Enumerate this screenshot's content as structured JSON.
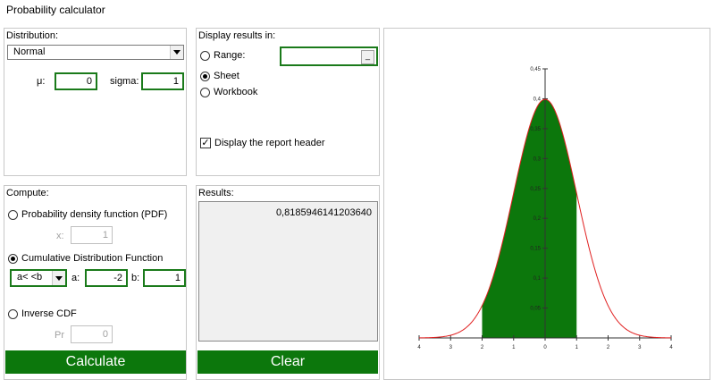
{
  "window": {
    "title": "Probability calculator"
  },
  "distribution": {
    "label": "Distribution:",
    "selected": "Normal",
    "mu_label": "μ:",
    "mu_value": "0",
    "sigma_label": "sigma:",
    "sigma_value": "1"
  },
  "display": {
    "label": "Display results in:",
    "range_label": "Range:",
    "range_value": "",
    "range_button": "_",
    "sheet_label": "Sheet",
    "workbook_label": "Workbook",
    "selected": "sheet",
    "header_label": "Display the report header",
    "header_checked": true
  },
  "compute": {
    "label": "Compute:",
    "pdf_label": "Probability density function (PDF)",
    "x_label": "x:",
    "x_value": "1",
    "cdf_label": "Cumulative Distribution Function",
    "cdf_selected": true,
    "cdf_mode": "a< <b",
    "a_label": "a:",
    "a_value": "-2",
    "b_label": "b:",
    "b_value": "1",
    "inv_label": "Inverse CDF",
    "pr_label": "Pr",
    "pr_value": "0"
  },
  "results": {
    "label": "Results:",
    "value": "0,8185946141203640"
  },
  "buttons": {
    "calculate": "Calculate",
    "clear": "Clear"
  },
  "colors": {
    "accent": "#0c770c",
    "input_border": "#1a7a1a",
    "curve": "#e02020",
    "fill": "#0c770c"
  },
  "chart_data": {
    "type": "area",
    "curve": "normal-pdf",
    "mu": 0,
    "sigma": 1,
    "shaded_from": -2,
    "shaded_to": 1,
    "xlim": [
      -4,
      4
    ],
    "ylim": [
      0,
      0.45
    ],
    "x_ticks": [
      "4",
      "3",
      "2",
      "1",
      "0",
      "1",
      "2",
      "3",
      "4"
    ],
    "x_tick_values": [
      -4,
      -3,
      -2,
      -1,
      0,
      1,
      2,
      3,
      4
    ],
    "y_ticks": [
      "0,05",
      "0,1",
      "0,15",
      "0,2",
      "0,25",
      "0,3",
      "0,35",
      "0,4",
      "0,45"
    ],
    "y_tick_values": [
      0.05,
      0.1,
      0.15,
      0.2,
      0.25,
      0.3,
      0.35,
      0.4,
      0.45
    ]
  }
}
